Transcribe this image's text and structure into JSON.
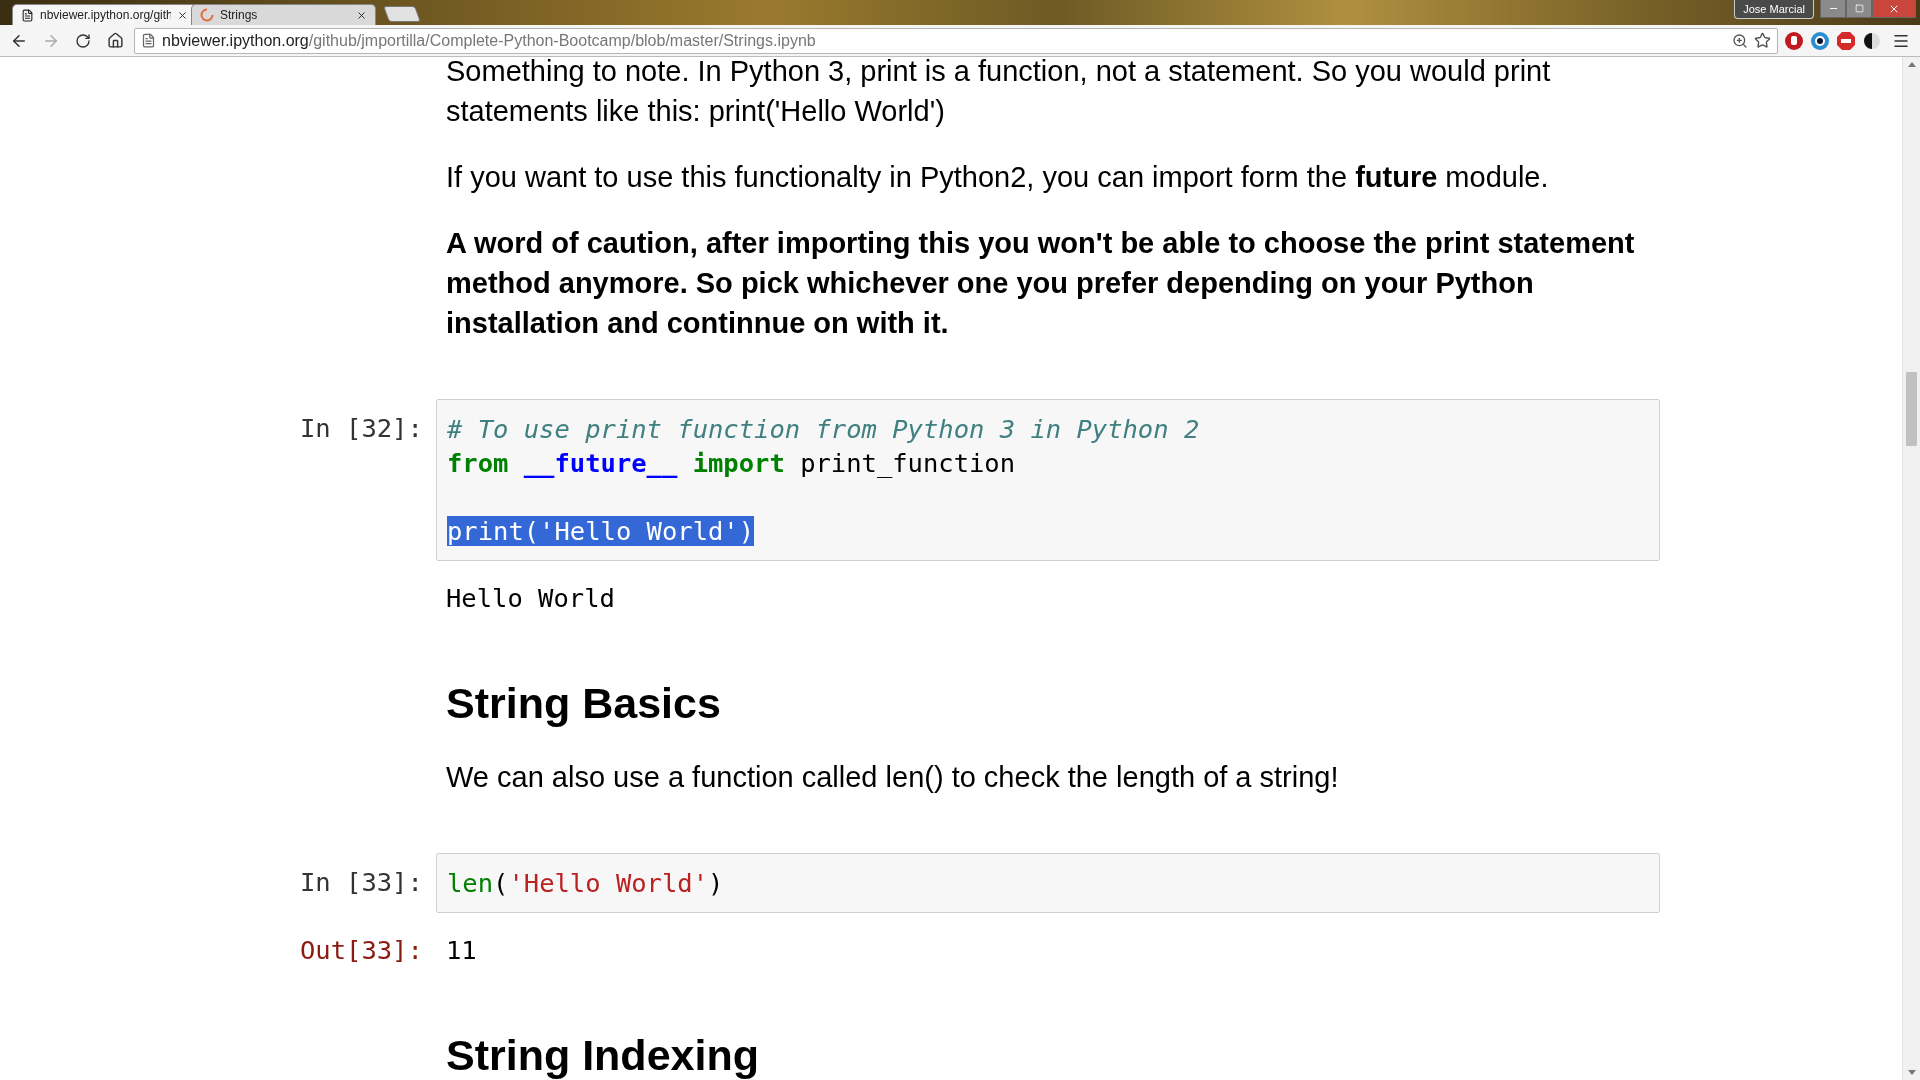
{
  "browser": {
    "tabs": [
      {
        "title": "nbviewer.ipython.org/gith",
        "kind": "page",
        "selected": true
      },
      {
        "title": "Strings",
        "kind": "loading",
        "selected": false
      }
    ],
    "profile_name": "Jose Marcial",
    "url": {
      "host": "nbviewer.ipython.org",
      "path": "/github/jmportilla/Complete-Python-Bootcamp/blob/master/Strings.ipynb"
    }
  },
  "cells": [
    {
      "kind": "text",
      "text": "Something to note. In Python 3, print is a function, not a statement. So you would print statements like this: print('Hello World')",
      "bold": false
    },
    {
      "kind": "text",
      "text": "If you want to use this functionalty in Python2, you can import form the **future** module.",
      "bold": false
    },
    {
      "kind": "text",
      "text": "A word of caution, after importing this you won't be able to choose the print statement method anymore. So pick whichever one you prefer depending on your Python installation and continnue on with it.",
      "bold": true
    },
    {
      "kind": "code",
      "prompt": "In [32]:",
      "lines": [
        {
          "kind": "code",
          "selected": false,
          "tokens": [
            {
              "kind": "comment",
              "text": "# To use print function from Python 3 in Python 2"
            }
          ]
        },
        {
          "kind": "code",
          "selected": false,
          "tokens": [
            {
              "kind": "keyword",
              "text": "from "
            },
            {
              "kind": "module",
              "text": "__future__ "
            },
            {
              "kind": "keyword",
              "text": "import "
            },
            {
              "kind": "plain",
              "text": "print_function"
            }
          ]
        },
        {
          "kind": "blank"
        },
        {
          "kind": "code",
          "selected": true,
          "tokens": [
            {
              "kind": "plain",
              "text": "print('Hello World')"
            }
          ]
        }
      ]
    },
    {
      "kind": "stream",
      "text": "Hello World"
    },
    {
      "kind": "heading",
      "text": "String Basics"
    },
    {
      "kind": "text",
      "text": "We can also use a function called len() to check the length of a string!",
      "bold": false
    },
    {
      "kind": "code",
      "prompt": "In [33]:",
      "lines": [
        {
          "kind": "code",
          "selected": false,
          "tokens": [
            {
              "kind": "builtin",
              "text": "len"
            },
            {
              "kind": "plain",
              "text": "("
            },
            {
              "kind": "string",
              "text": "'Hello World'"
            },
            {
              "kind": "plain",
              "text": ")"
            }
          ]
        }
      ]
    },
    {
      "kind": "result",
      "prompt": "Out[33]:",
      "text": "11"
    },
    {
      "kind": "heading",
      "text": "String Indexing"
    }
  ]
}
